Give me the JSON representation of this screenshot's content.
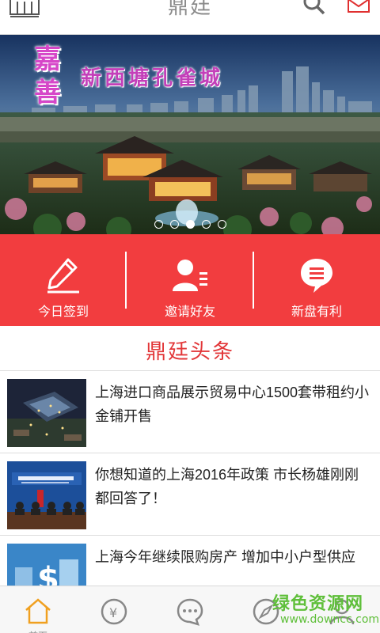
{
  "header": {
    "title": "鼎廷"
  },
  "banner": {
    "brand": "嘉善",
    "slogan": "新西塘孔雀城",
    "slide_count": 5,
    "active_slide": 3
  },
  "actions": [
    {
      "label": "今日签到",
      "icon": "pencil-icon"
    },
    {
      "label": "邀请好友",
      "icon": "invite-contact-icon"
    },
    {
      "label": "新盘有利",
      "icon": "chat-bubble-icon"
    }
  ],
  "section": {
    "title": "鼎廷头条"
  },
  "news": [
    {
      "headline": "上海进口商品展示贸易中心1500套带租约小金铺开售",
      "thumb": "night-aerial-image"
    },
    {
      "headline": "你想知道的上海2016年政策 市长杨雄刚刚都回答了！",
      "thumb": "press-conference-image"
    },
    {
      "headline": "上海今年继续限购房产 增加中小户型供应",
      "thumb": "money-building-image"
    }
  ],
  "bottom_nav": [
    {
      "label": "首页",
      "icon": "home-icon"
    },
    {
      "label": "",
      "icon": "money-bag-icon"
    },
    {
      "label": "",
      "icon": "chat-icon"
    },
    {
      "label": "",
      "icon": "compass-icon"
    },
    {
      "label": "",
      "icon": "user-icon"
    }
  ],
  "watermark": {
    "text": "绿色资源网",
    "url": "www.downcc.com"
  },
  "colors": {
    "accent_red": "#f23d3f",
    "section_title": "#e23638",
    "nav_active": "#f0a020",
    "watermark": "#5fbf3a"
  }
}
